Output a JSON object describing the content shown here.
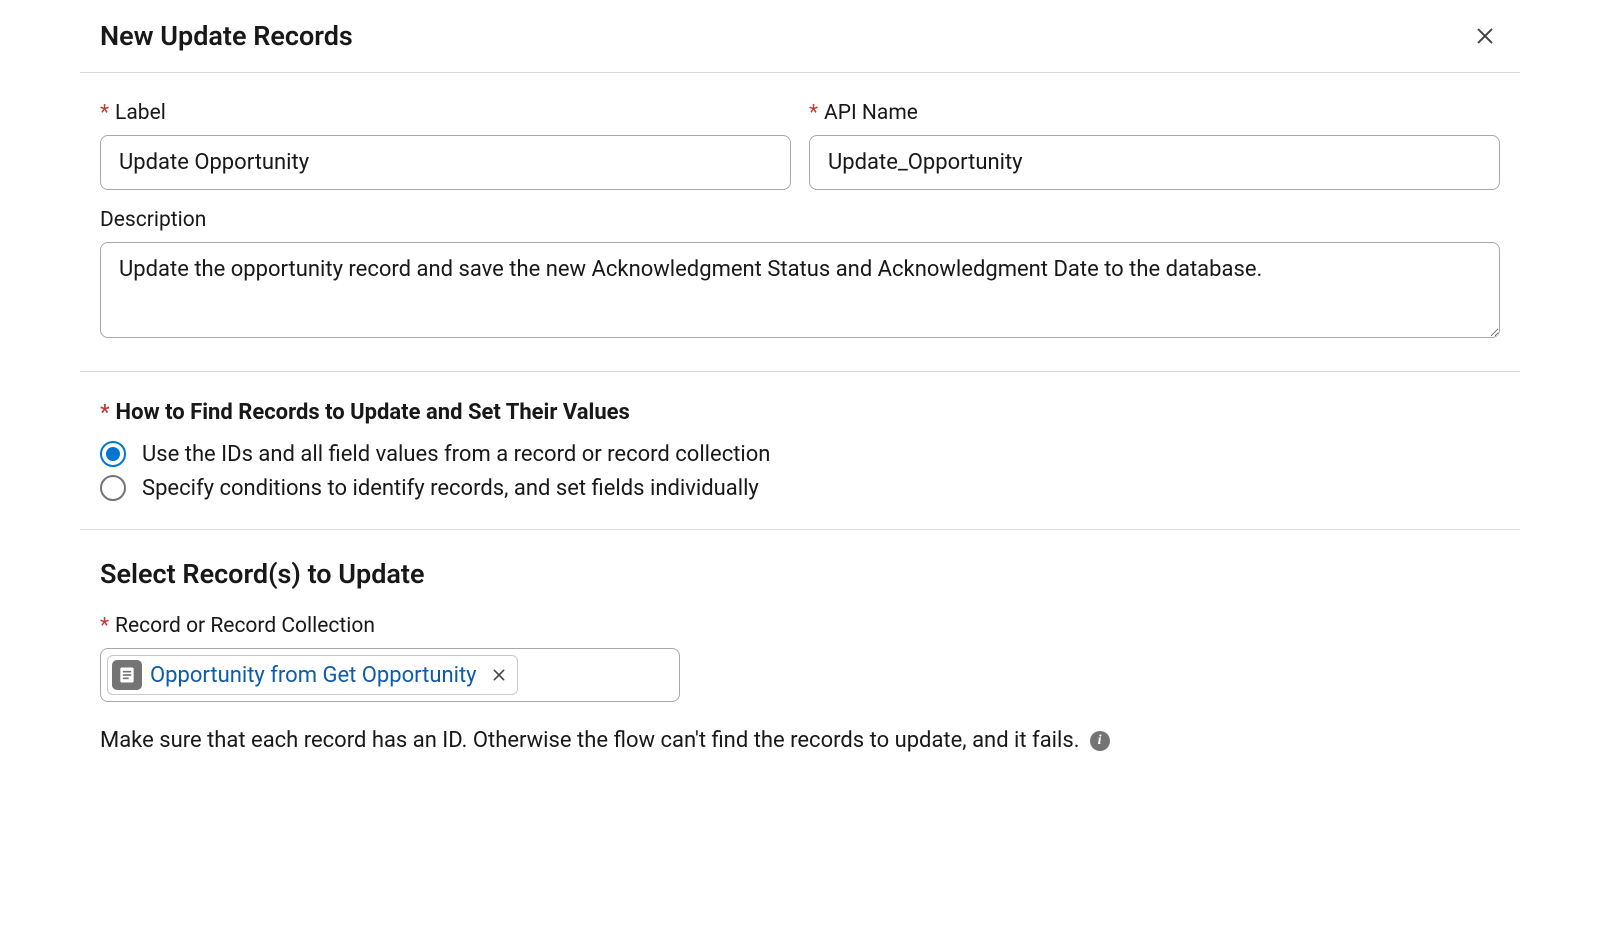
{
  "header": {
    "title": "New Update Records"
  },
  "fields": {
    "label": {
      "label": "Label",
      "value": "Update Opportunity"
    },
    "apiName": {
      "label": "API Name",
      "value": "Update_Opportunity"
    },
    "description": {
      "label": "Description",
      "value": "Update the opportunity record and save the new Acknowledgment Status and Acknowledgment Date to the database."
    }
  },
  "howToFind": {
    "heading": "How to Find Records to Update and Set Their Values",
    "options": [
      {
        "label": "Use the IDs and all field values from a record or record collection",
        "checked": true
      },
      {
        "label": "Specify conditions to identify records, and set fields individually",
        "checked": false
      }
    ]
  },
  "selectRecords": {
    "title": "Select Record(s) to Update",
    "lookupLabel": "Record or Record Collection",
    "pill": {
      "text": "Opportunity from Get Opportunity"
    },
    "hint": "Make sure that each record has an ID. Otherwise the flow can't find the records to update, and it fails."
  }
}
